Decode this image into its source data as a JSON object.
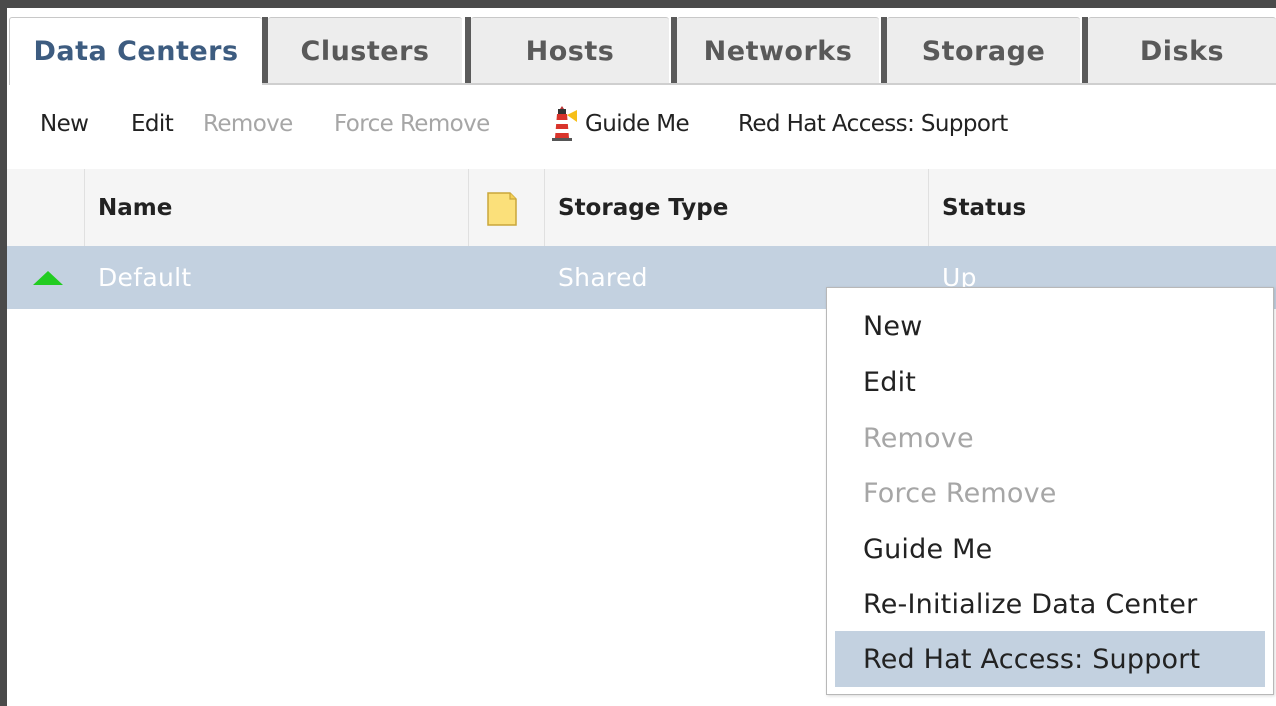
{
  "tabs": [
    {
      "label": "Data Centers",
      "active": true
    },
    {
      "label": "Clusters"
    },
    {
      "label": "Hosts"
    },
    {
      "label": "Networks"
    },
    {
      "label": "Storage"
    },
    {
      "label": "Disks"
    }
  ],
  "toolbar": {
    "new": "New",
    "edit": "Edit",
    "remove": "Remove",
    "force_remove": "Force Remove",
    "guide_me": "Guide Me",
    "support": "Red Hat Access: Support",
    "guide_icon": "lighthouse-icon"
  },
  "grid": {
    "columns": [
      "Name",
      "Storage Type",
      "Status"
    ],
    "comment_column_icon": "note-icon",
    "rows": [
      {
        "status_icon": "up-arrow-icon",
        "name": "Default",
        "storage_type": "Shared",
        "status": "Up",
        "selected": true
      }
    ]
  },
  "context_menu": {
    "items": [
      {
        "label": "New",
        "enabled": true
      },
      {
        "label": "Edit",
        "enabled": true
      },
      {
        "label": "Remove",
        "enabled": false
      },
      {
        "label": "Force Remove",
        "enabled": false
      },
      {
        "label": "Guide Me",
        "enabled": true
      },
      {
        "label": "Re-Initialize Data Center",
        "enabled": true
      },
      {
        "label": "Red Hat Access: Support",
        "enabled": true,
        "highlighted": true
      }
    ]
  },
  "colors": {
    "active_tab_text": "#3d5c80",
    "selected_row": "#c3d1e0",
    "status_up": "#22cc22",
    "disabled_text": "#a6a6a6"
  }
}
